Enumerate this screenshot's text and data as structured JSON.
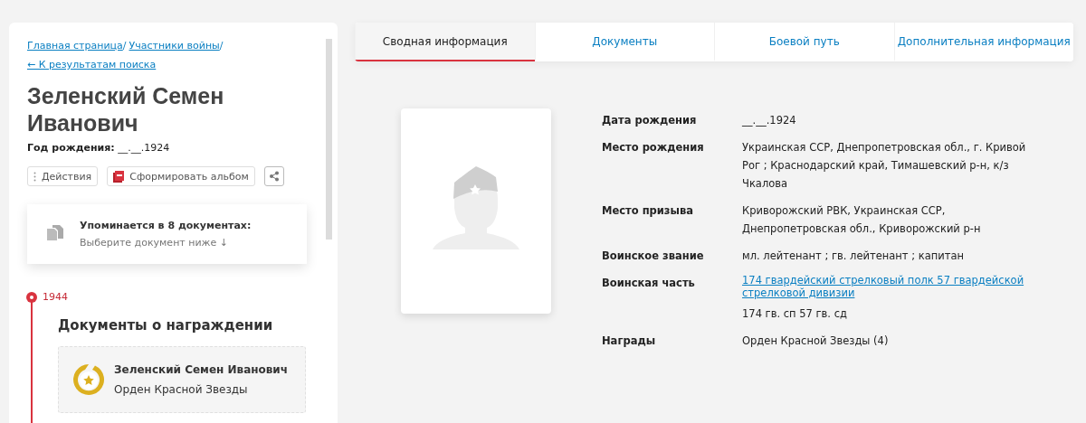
{
  "breadcrumbs": [
    {
      "label": "Главная страница",
      "separator": "/"
    },
    {
      "label": "Участники войны",
      "separator": "/"
    }
  ],
  "back_link": "← К результатам поиска",
  "person": {
    "name": "Зеленский Семен Иванович",
    "birth_label": "Год рождения:",
    "birth_value": "__.__.1924"
  },
  "actions": [
    {
      "kind": "menu",
      "label": "Действия"
    },
    {
      "kind": "pdf",
      "label": "Сформировать альбом"
    },
    {
      "kind": "share"
    }
  ],
  "mentions": {
    "title": "Упоминается в 8 документах:",
    "hint": "Выберите документ ниже",
    "arrow": "↓"
  },
  "timeline": {
    "year": "1944",
    "section_title": "Документы о награждении",
    "cards": [
      {
        "name": "Зеленский Семен Иванович",
        "award": "Орден Красной Звезды"
      }
    ]
  },
  "tabs": [
    {
      "label": "Сводная информация",
      "selected": true
    },
    {
      "label": "Документы",
      "selected": false
    },
    {
      "label": "Боевой путь",
      "selected": false
    },
    {
      "label": "Дополнительная информация",
      "selected": false
    }
  ],
  "photo": {
    "kind": "placeholder"
  },
  "info": [
    {
      "label": "Дата рождения",
      "values": [
        {
          "kind": "text",
          "text": "__.__.1924"
        }
      ]
    },
    {
      "label": "Место рождения",
      "values": [
        {
          "kind": "text",
          "text": "Украинская ССР, Днепропетровская обл., г. Кривой Рог ; Краснодарский край, Тимашевский р-н, к/з Чкалова"
        }
      ]
    },
    {
      "label": "Место призыва",
      "values": [
        {
          "kind": "text",
          "text": "Криворожский РВК, Украинская ССР, Днепропетровская обл., Криворожский р-н"
        }
      ]
    },
    {
      "label": "Воинское звание",
      "values": [
        {
          "kind": "text",
          "text": "мл. лейтенант ; гв. лейтенант ; капитан"
        }
      ]
    },
    {
      "label": "Воинская часть",
      "values": [
        {
          "kind": "link",
          "text": "174 гвардейский стрелковый полк 57 гвардейской стрелковой дивизии"
        },
        {
          "kind": "text",
          "text": "174 гв. сп 57 гв. сд"
        }
      ]
    },
    {
      "label": "Награды",
      "values": [
        {
          "kind": "text",
          "text": "Орден Красной Звезды (4)"
        }
      ]
    }
  ]
}
